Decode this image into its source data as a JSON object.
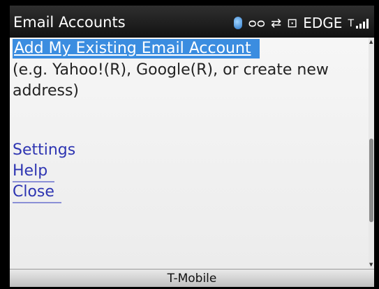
{
  "status_bar": {
    "title": "Email Accounts",
    "icons": [
      "bluetooth-icon",
      "voicemail-icon",
      "data-connection-icon",
      "unlock-icon",
      "signal-strength-icon"
    ],
    "network_type": "EDGE",
    "signal_bars": 4
  },
  "menu": {
    "add_account": "Add My Existing Email Account",
    "add_account_desc": "(e.g. Yahoo!(R), Google(R), or create new address)",
    "settings": "Settings",
    "help": "Help",
    "close": "Close"
  },
  "carrier": {
    "name": "T-Mobile"
  },
  "colors": {
    "selection": "#3b8de0",
    "link": "#2e35b2",
    "status_bar_bg": "#1e1e1e"
  }
}
